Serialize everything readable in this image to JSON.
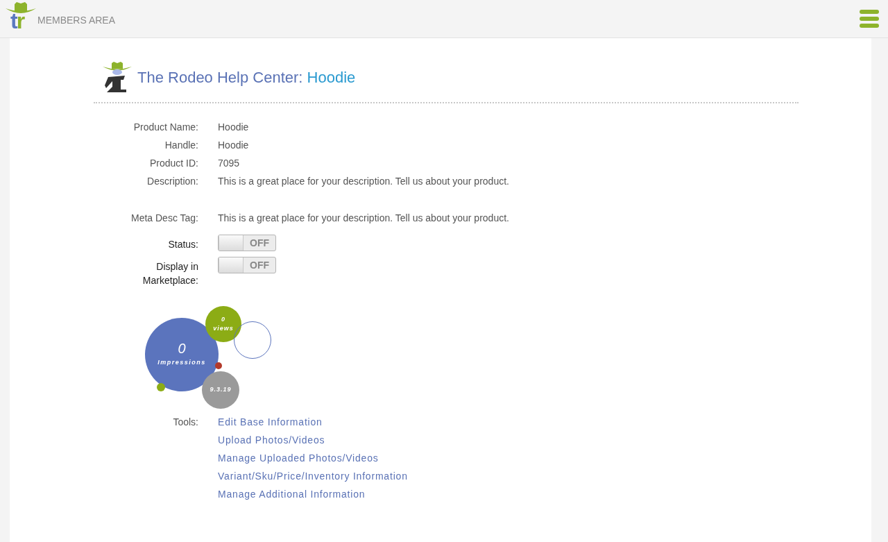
{
  "header": {
    "logo_text": "tr",
    "title": "MEMBERS AREA"
  },
  "page_title": {
    "prefix": "The Rodeo Help Center:",
    "product": "Hoodie"
  },
  "fields": [
    {
      "label": "Product Name:",
      "value": "Hoodie"
    },
    {
      "label": "Handle:",
      "value": "Hoodie"
    },
    {
      "label": "Product ID:",
      "value": "7095"
    },
    {
      "label": "Description:",
      "value": "This is a great place for your description. Tell us about your product."
    },
    {
      "label": "Meta Desc Tag:",
      "value": "This is a great place for your description. Tell us about your product."
    }
  ],
  "toggles": [
    {
      "label": "Status:",
      "on": false,
      "text": "OFF"
    },
    {
      "label": "Display in Marketplace:",
      "on": false,
      "text": "OFF"
    }
  ],
  "stats": {
    "impressions_value": "0",
    "impressions_label": "Impressions",
    "views_value": "0",
    "views_label": "views",
    "date": "9.3.19"
  },
  "tools": {
    "label": "Tools:",
    "links": [
      "Edit Base Information",
      "Upload Photos/Videos",
      "Manage Uploaded Photos/Videos",
      "Variant/Sku/Price/Inventory Information",
      "Manage Additional Information"
    ]
  }
}
